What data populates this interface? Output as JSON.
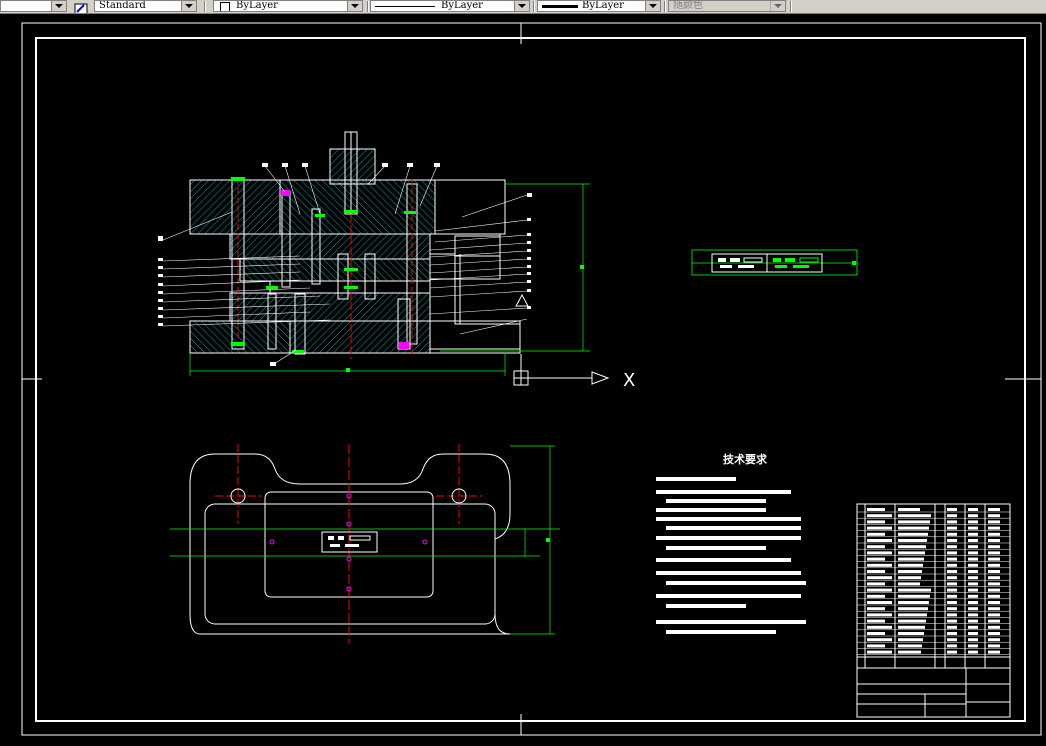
{
  "toolbar": {
    "text_style": "Standard",
    "layer_color": "ByLayer",
    "linetype": "ByLayer",
    "lineweight": "ByLayer",
    "plot_style": "随颜色"
  },
  "drawing": {
    "tech_req_title": "技术要求",
    "axis_x_label": "X"
  },
  "colors": {
    "background": "#000000",
    "outline": "#ffffff",
    "dimension": "#00ff00",
    "hatch": "#00cccc",
    "centerline": "#ff0000",
    "marker": "#ff00ff"
  }
}
